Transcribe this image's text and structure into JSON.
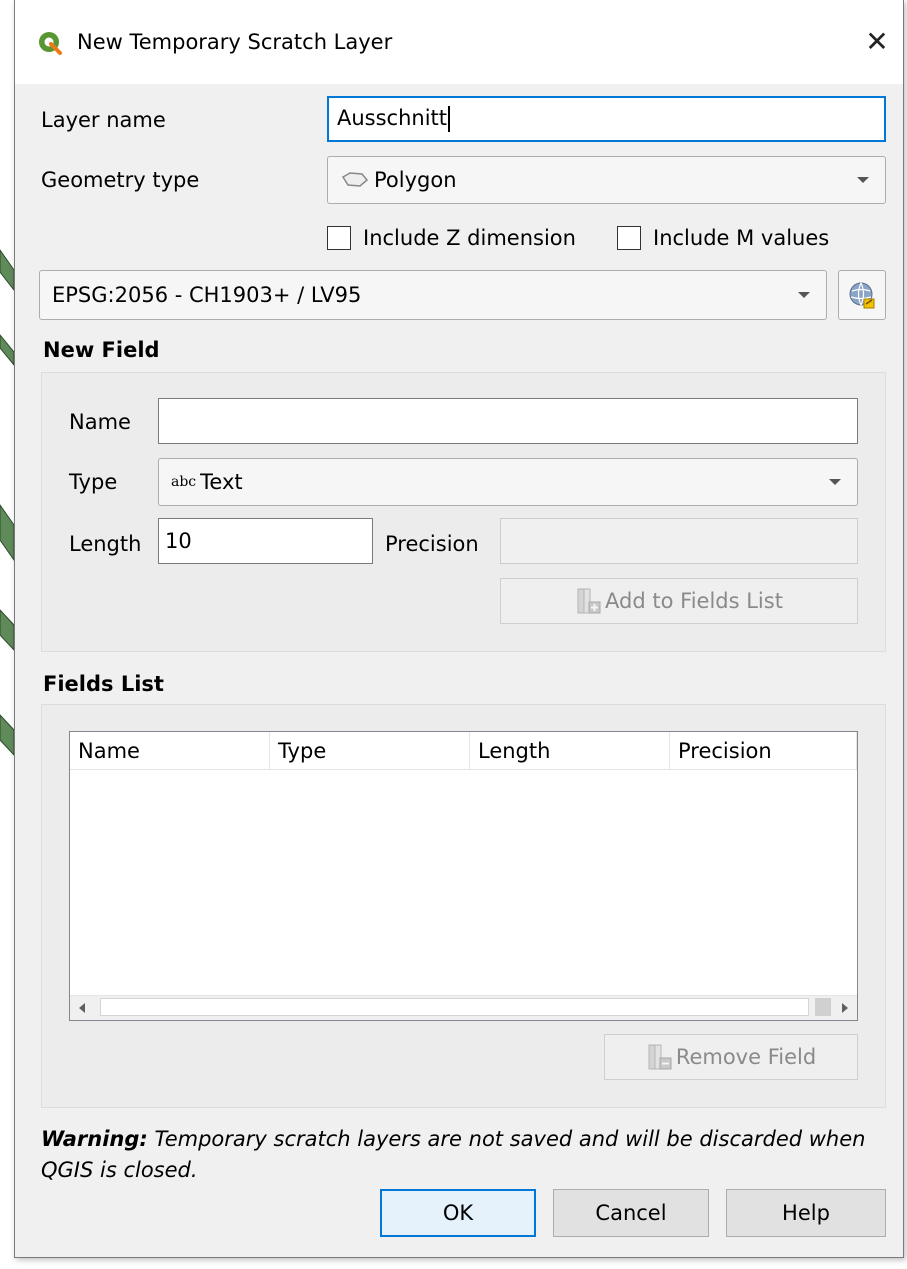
{
  "dialog": {
    "title": "New Temporary Scratch Layer",
    "close_glyph": "✕"
  },
  "layer": {
    "name_label": "Layer name",
    "name_value": "Ausschnitt",
    "geometry_label": "Geometry type",
    "geometry_value": "Polygon",
    "include_z_label": "Include Z dimension",
    "include_z_checked": false,
    "include_m_label": "Include M values",
    "include_m_checked": false,
    "crs_value": "EPSG:2056 - CH1903+ / LV95"
  },
  "new_field": {
    "section_title": "New Field",
    "name_label": "Name",
    "name_value": "",
    "type_label": "Type",
    "type_prefix": "abc",
    "type_value": "Text",
    "length_label": "Length",
    "length_value": "10",
    "precision_label": "Precision",
    "precision_value": "",
    "add_button_label": "Add to Fields List"
  },
  "fields_list": {
    "section_title": "Fields List",
    "columns": [
      "Name",
      "Type",
      "Length",
      "Precision"
    ],
    "rows": [],
    "remove_button_label": "Remove Field"
  },
  "warning": {
    "prefix": "Warning:",
    "text": " Temporary scratch layers are not saved and will be discarded when QGIS is closed."
  },
  "buttons": {
    "ok": "OK",
    "cancel": "Cancel",
    "help": "Help"
  },
  "icons": {
    "app": "qgis-logo-icon",
    "geometry": "polygon-icon",
    "crs_selector": "crs-globe-icon",
    "add_field": "add-field-icon",
    "remove_field": "remove-field-icon"
  },
  "colors": {
    "focus_border": "#0078d7",
    "qgis_green": "#589632",
    "dialog_bg": "#f0f0f0"
  }
}
